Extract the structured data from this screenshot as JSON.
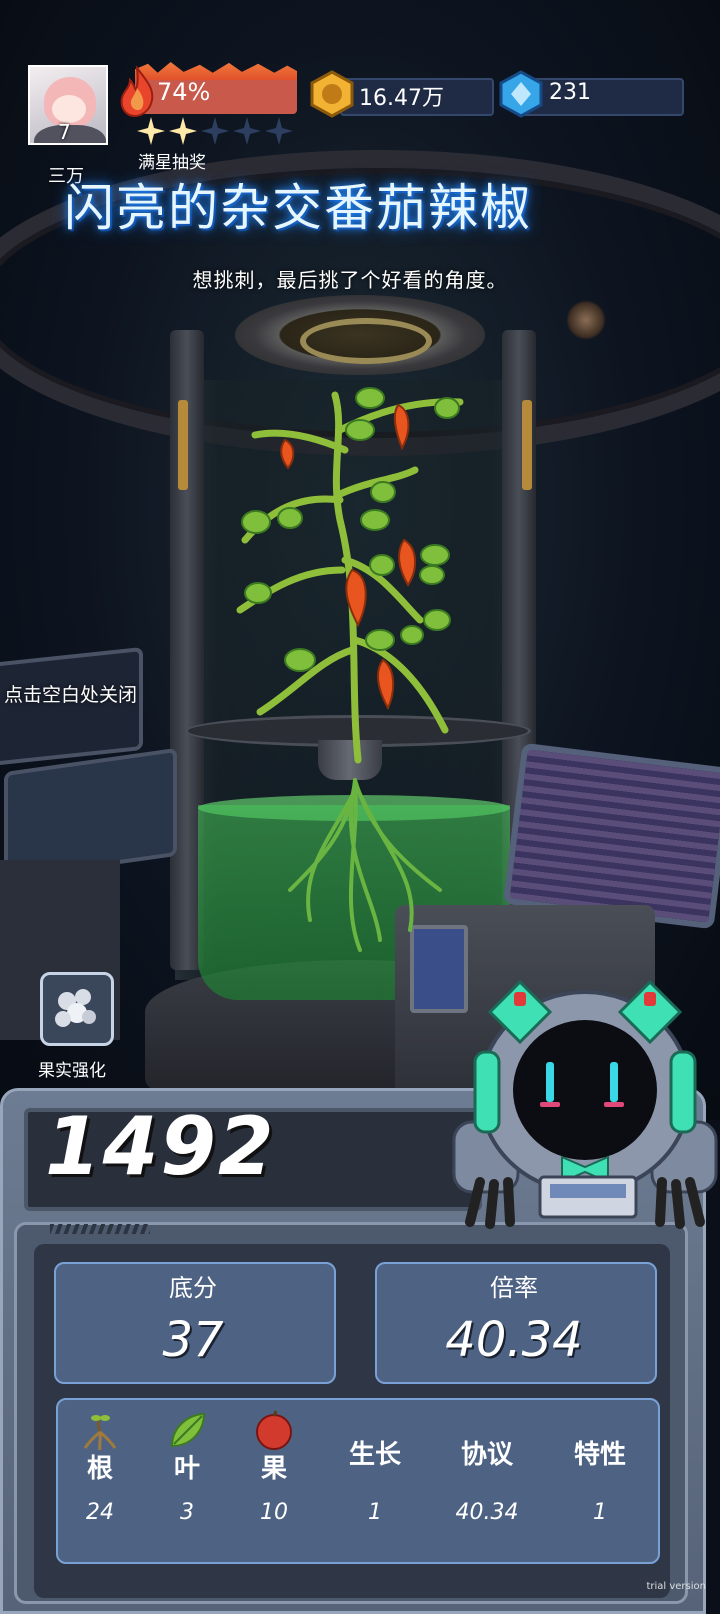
{
  "player": {
    "level": "7"
  },
  "heat": {
    "percent": "74%",
    "stars_filled": 2,
    "stars_total": 5,
    "star_label": "满星抽奖"
  },
  "currency": {
    "coins": "16.47万",
    "gems": "231"
  },
  "plant": {
    "tag": "三万",
    "name": "闪亮的杂交番茄辣椒",
    "comment": "想挑刺，最后挑了个好看的角度。"
  },
  "hint": {
    "close": "点击空白处关闭"
  },
  "fruit_button": {
    "label": "果实强化"
  },
  "score": {
    "total": "1492"
  },
  "stats": {
    "base_label": "底分",
    "base_value": "37",
    "mult_label": "倍率",
    "mult_value": "40.34"
  },
  "breakdown": {
    "columns": [
      {
        "label": "根",
        "value": "24",
        "icon": "root-icon"
      },
      {
        "label": "叶",
        "value": "3",
        "icon": "leaf-icon"
      },
      {
        "label": "果",
        "value": "10",
        "icon": "apple-icon"
      },
      {
        "label": "生长",
        "value": "1"
      },
      {
        "label": "协议",
        "value": "40.34"
      },
      {
        "label": "特性",
        "value": "1"
      }
    ]
  },
  "watermark": "trial version",
  "colors": {
    "title_glow": "#1f8cff",
    "heat": "#c9594a",
    "panel": "#566378",
    "card": "#4e6383",
    "liquid": "#46c85a"
  }
}
